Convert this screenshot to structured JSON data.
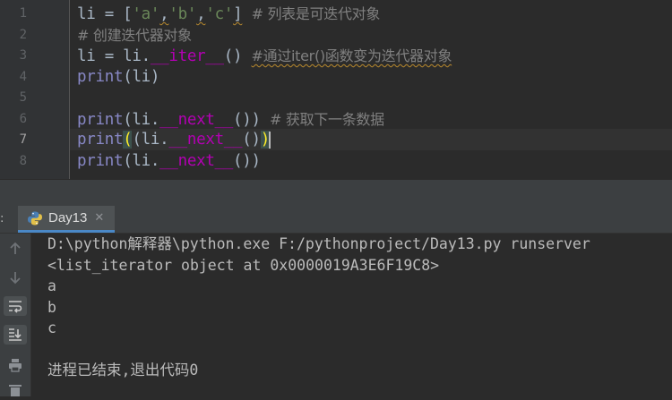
{
  "editor": {
    "line_numbers": [
      "1",
      "2",
      "3",
      "4",
      "5",
      "6",
      "7",
      "8"
    ],
    "lines": [
      {
        "id": "l1",
        "text": ""
      },
      {
        "id": "l2",
        "comment": "# 创建迭代器对象"
      },
      {
        "id": "l3",
        "text": ""
      },
      {
        "id": "l4",
        "text": "print(li)"
      },
      {
        "id": "l5",
        "text": ""
      },
      {
        "id": "l6",
        "text": ""
      },
      {
        "id": "l7",
        "text": ""
      },
      {
        "id": "l8",
        "text": ""
      }
    ],
    "tokens": {
      "l1_var": "li = [",
      "l1_a": "'a'",
      "l1_comma1": ",",
      "l1_b": "'b'",
      "l1_comma2": ",",
      "l1_c": "'c'",
      "l1_close": "]",
      "l1_comment": "# 列表是可迭代对象",
      "l3_pre": "li = li.",
      "l3_iter": "__iter__",
      "l3_call": "()",
      "l3_comment": "#通过iter()函数变为迭代器对象",
      "print": "print",
      "li_dot": "(li.",
      "next": "__next__",
      "call_close": "())",
      "call_open": "()",
      "paren_close": ")",
      "paren_open": "(",
      "l6_comment": "# 获取下一条数据"
    }
  },
  "run_panel": {
    "prefix": ":",
    "tab_title": "Day13",
    "tab_close": "✕"
  },
  "tools": [
    "up-arrow",
    "down-arrow",
    "soft-wrap",
    "scroll-to-end",
    "print",
    "delete"
  ],
  "console": {
    "lines": [
      "D:\\python解释器\\python.exe F:/pythonproject/Day13.py runserver",
      "<list_iterator object at 0x0000019A3E6F19C8>",
      "a",
      "b",
      "c",
      "",
      "进程已结束,退出代码0"
    ]
  },
  "colors": {
    "background": "#2b2b2b",
    "string": "#6a8759",
    "comment": "#808080",
    "builtin": "#8888c6",
    "magic": "#b200b2",
    "tab_accent": "#4a88c7"
  }
}
